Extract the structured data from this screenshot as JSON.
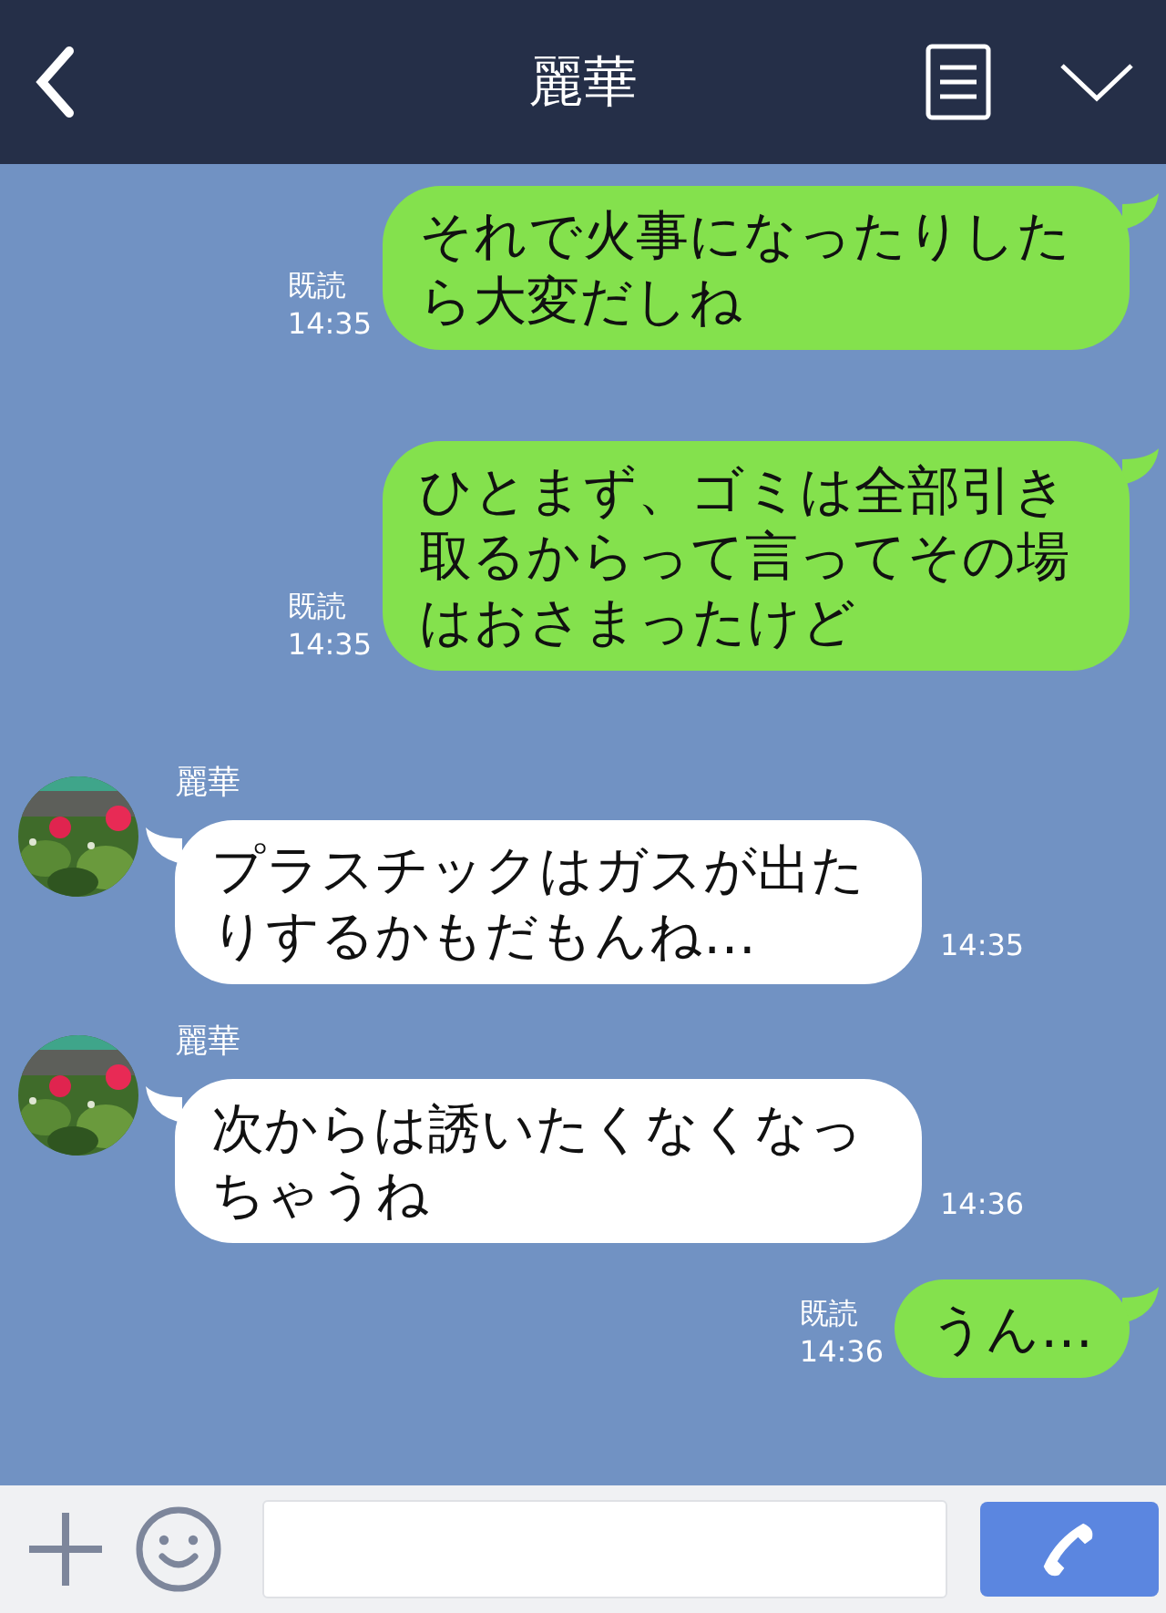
{
  "header": {
    "title": "麗華"
  },
  "messages": [
    {
      "kind": "sent",
      "text": "それで火事になったりしたら大変だしね",
      "read": "既読",
      "time": "14:35"
    },
    {
      "kind": "sent",
      "text": "ひとまず、ゴミは全部引き取るからって言ってその場はおさまったけど",
      "read": "既読",
      "time": "14:35"
    },
    {
      "kind": "received",
      "name": "麗華",
      "text": "プラスチックはガスが出たりするかもだもんね…",
      "time": "14:35"
    },
    {
      "kind": "received",
      "name": "麗華",
      "text": "次からは誘いたくなくなっちゃうね",
      "time": "14:36"
    },
    {
      "kind": "sent",
      "text": "うん…",
      "read": "既読",
      "time": "14:36"
    }
  ]
}
